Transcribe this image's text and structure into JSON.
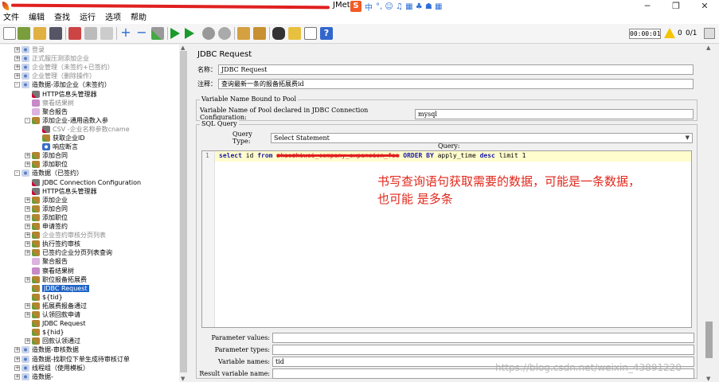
{
  "window": {
    "app_name": "JMet",
    "ime": {
      "brand": "S",
      "mode": "中",
      "extra_glyphs": "°, ☺ ♫ ▦ ♣ ☗ ▦"
    },
    "controls": {
      "minimize": "─",
      "maximize": "❐",
      "close": "✕"
    }
  },
  "menu": [
    "文件",
    "编辑",
    "查找",
    "运行",
    "选项",
    "帮助"
  ],
  "toolbar": {
    "timer": "00:00:01",
    "warnings": "0",
    "threads": "0/1"
  },
  "tree": {
    "items": [
      {
        "label": "登录",
        "depth": 1,
        "toggle": "+",
        "icon": "gear",
        "disabled": true
      },
      {
        "label": "正式服压测添加企业",
        "depth": 1,
        "toggle": "+",
        "icon": "gear",
        "disabled": true
      },
      {
        "label": "企业管理（未签约+已签约）",
        "depth": 1,
        "toggle": "+",
        "icon": "gear",
        "disabled": true
      },
      {
        "label": "企业管理（删除操作）",
        "depth": 1,
        "toggle": "+",
        "icon": "gear",
        "disabled": true
      },
      {
        "label": "造数据-添加企业（未签约）",
        "depth": 1,
        "toggle": "-",
        "icon": "gear",
        "disabled": false
      },
      {
        "label": "HTTP信息头管理器",
        "depth": 2,
        "toggle": "",
        "icon": "config",
        "disabled": false
      },
      {
        "label": "察看结果树",
        "depth": 2,
        "toggle": "",
        "icon": "listener",
        "disabled": true
      },
      {
        "label": "聚合报告",
        "depth": 2,
        "toggle": "",
        "icon": "report",
        "disabled": false
      },
      {
        "label": "添加企业-通用函数入参",
        "depth": 2,
        "toggle": "-",
        "icon": "sampler",
        "disabled": false
      },
      {
        "label": "CSV -企业名称参数cname",
        "depth": 3,
        "toggle": "",
        "icon": "config",
        "disabled": true
      },
      {
        "label": "获取企业ID",
        "depth": 3,
        "toggle": "",
        "icon": "sampler",
        "disabled": false
      },
      {
        "label": "响应断言",
        "depth": 3,
        "toggle": "",
        "icon": "magnifier",
        "disabled": false
      },
      {
        "label": "添加合同",
        "depth": 2,
        "toggle": "+",
        "icon": "sampler",
        "disabled": false
      },
      {
        "label": "添加职位",
        "depth": 2,
        "toggle": "+",
        "icon": "sampler",
        "disabled": false
      },
      {
        "label": "造数据（已签约）",
        "depth": 1,
        "toggle": "-",
        "icon": "gear",
        "disabled": false
      },
      {
        "label": "JDBC Connection Configuration",
        "depth": 2,
        "toggle": "",
        "icon": "config",
        "disabled": false
      },
      {
        "label": "HTTP信息头管理器",
        "depth": 2,
        "toggle": "",
        "icon": "config",
        "disabled": false
      },
      {
        "label": "添加企业",
        "depth": 2,
        "toggle": "+",
        "icon": "sampler",
        "disabled": false
      },
      {
        "label": "添加合同",
        "depth": 2,
        "toggle": "+",
        "icon": "sampler",
        "disabled": false
      },
      {
        "label": "添加职位",
        "depth": 2,
        "toggle": "+",
        "icon": "sampler",
        "disabled": false
      },
      {
        "label": "申请签约",
        "depth": 2,
        "toggle": "+",
        "icon": "sampler",
        "disabled": false
      },
      {
        "label": "企业签约审核分页列表",
        "depth": 2,
        "toggle": "+",
        "icon": "sampler",
        "disabled": true
      },
      {
        "label": "执行签约审核",
        "depth": 2,
        "toggle": "+",
        "icon": "sampler",
        "disabled": false
      },
      {
        "label": "已签约企业分页列表查询",
        "depth": 2,
        "toggle": "+",
        "icon": "sampler",
        "disabled": false
      },
      {
        "label": "聚合报告",
        "depth": 2,
        "toggle": "",
        "icon": "report",
        "disabled": false
      },
      {
        "label": "察看结果树",
        "depth": 2,
        "toggle": "",
        "icon": "listener",
        "disabled": false
      },
      {
        "label": "职位报备拓展费",
        "depth": 2,
        "toggle": "+",
        "icon": "sampler",
        "disabled": false
      },
      {
        "label": "JDBC Request",
        "depth": 2,
        "toggle": "",
        "icon": "sampler",
        "disabled": false,
        "selected": true
      },
      {
        "label": "${tid}",
        "depth": 2,
        "toggle": "",
        "icon": "sampler",
        "disabled": false
      },
      {
        "label": "拓展费报备通过",
        "depth": 2,
        "toggle": "+",
        "icon": "sampler",
        "disabled": false
      },
      {
        "label": "认领回款申请",
        "depth": 2,
        "toggle": "+",
        "icon": "sampler",
        "disabled": false
      },
      {
        "label": "JDBC Request",
        "depth": 2,
        "toggle": "",
        "icon": "sampler",
        "disabled": false
      },
      {
        "label": "${hid}",
        "depth": 2,
        "toggle": "",
        "icon": "sampler",
        "disabled": false
      },
      {
        "label": "回款认领通过",
        "depth": 2,
        "toggle": "+",
        "icon": "sampler",
        "disabled": false
      },
      {
        "label": "造数据-审核数据",
        "depth": 1,
        "toggle": "+",
        "icon": "gear",
        "disabled": false
      },
      {
        "label": "造数据-找职位下单生成待审核订单",
        "depth": 1,
        "toggle": "+",
        "icon": "gear",
        "disabled": false
      },
      {
        "label": "线程组（使用模板）",
        "depth": 1,
        "toggle": "+",
        "icon": "gear",
        "disabled": false
      },
      {
        "label": "造数据-",
        "depth": 1,
        "toggle": "+",
        "icon": "gear",
        "disabled": false
      }
    ]
  },
  "panel": {
    "title": "JDBC Request",
    "name_label": "名称：",
    "name_value": "JDBC Request",
    "comment_label": "注释：",
    "comment_value": "查询最新一条的报备拓展费id",
    "pool_group": "Variable Name Bound to Pool",
    "pool_label": "Variable Name of Pool declared in JDBC Connection Configuration:",
    "pool_value": "mysql",
    "sql_group": "SQL Query",
    "query_type_label": "Query Type:",
    "query_type_value": "Select Statement",
    "query_label": "Query:",
    "query": {
      "line_no": "1",
      "kw_select": "select",
      "col": "id",
      "kw_from": "from",
      "table": "zhaozhiwei_company_expansion_fee",
      "kw_order": "ORDER BY",
      "order_col": "apply_time",
      "kw_desc": "desc",
      "limit": "limit 1"
    },
    "annotation_line1": "书写查询语句获取需要的数据，可能是一条数据，",
    "annotation_line2": "也可能  是多条",
    "param_values_label": "Parameter values:",
    "param_types_label": "Parameter types:",
    "var_names_label": "Variable names:",
    "var_names_value": "tid",
    "result_var_label": "Result variable name:"
  },
  "watermark": "https://blog.csdn.net/weixin_43891220"
}
